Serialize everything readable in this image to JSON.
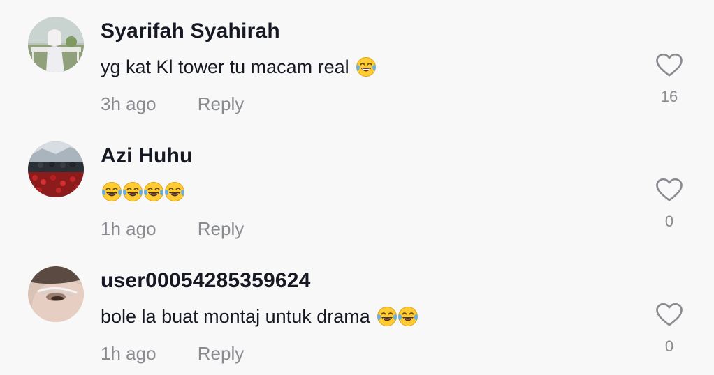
{
  "comments": [
    {
      "username": "Syarifah Syahirah",
      "text": "yg kat Kl tower tu macam real",
      "emoji_count": 1,
      "time": "3h ago",
      "reply_label": "Reply",
      "likes": "16"
    },
    {
      "username": "Azi Huhu",
      "text": "",
      "emoji_count": 4,
      "time": "1h ago",
      "reply_label": "Reply",
      "likes": "0"
    },
    {
      "username": "user00054285359624",
      "text": "bole la buat montaj untuk drama",
      "emoji_count": 2,
      "time": "1h ago",
      "reply_label": "Reply",
      "likes": "0"
    }
  ],
  "icons": {
    "like": "heart-outline-icon",
    "emoji": "face-with-tears-of-joy-emoji"
  },
  "colors": {
    "background": "#f8f8f8",
    "primary_text": "#161823",
    "secondary_text": "#8a8b91"
  }
}
